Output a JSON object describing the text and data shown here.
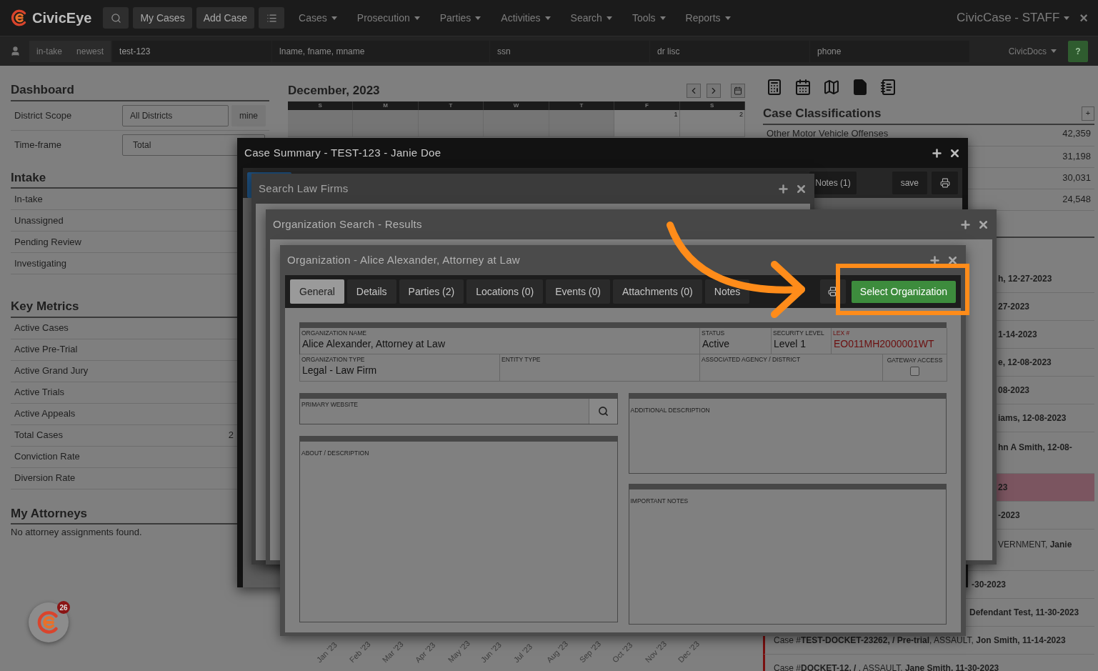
{
  "header": {
    "logo": "CivicEye",
    "nav_buttons": [
      "My Cases",
      "Add Case"
    ],
    "menus": [
      "Cases",
      "Prosecution",
      "Parties",
      "Activities",
      "Search",
      "Tools",
      "Reports"
    ],
    "account": "CivicCase - STAFF",
    "close": "×"
  },
  "search_bar": {
    "filters": [
      "in-take",
      "newest"
    ],
    "case_field": {
      "value": "test-123"
    },
    "fields": [
      {
        "placeholder": "lname, fname, mname"
      },
      {
        "placeholder": "ssn"
      },
      {
        "placeholder": "dr lisc"
      },
      {
        "placeholder": "phone"
      }
    ],
    "docs_menu": "CivicDocs",
    "help": "?"
  },
  "dashboard": {
    "title": "Dashboard",
    "scope": {
      "label": "District Scope",
      "value": "All Districts",
      "button": "mine"
    },
    "timeframe": {
      "label": "Time-frame",
      "value": "Total"
    }
  },
  "intake": {
    "title": "Intake",
    "rows": [
      "In-take",
      "Unassigned",
      "Pending Review",
      "Investigating"
    ]
  },
  "key_metrics": {
    "title": "Key Metrics",
    "rows": [
      {
        "label": "Active Cases"
      },
      {
        "label": "Active Pre-Trial"
      },
      {
        "label": "Active Grand Jury"
      },
      {
        "label": "Active Trials"
      },
      {
        "label": "Active Appeals"
      },
      {
        "label": "Total Cases",
        "value": "2"
      },
      {
        "label": "Conviction Rate"
      },
      {
        "label": "Diversion Rate"
      }
    ]
  },
  "attorneys": {
    "title": "My Attorneys",
    "empty": "No attorney assignments found."
  },
  "calendar": {
    "title": "December, 2023",
    "weekdays": [
      {
        "label": "S"
      },
      {
        "label": "M"
      },
      {
        "label": "T"
      },
      {
        "label": "W"
      },
      {
        "label": "T"
      },
      {
        "label": "F",
        "first_date": "1"
      },
      {
        "label": "S",
        "first_date": "2"
      }
    ]
  },
  "classifications": {
    "title": "Case Classifications",
    "add": "+",
    "rows": [
      {
        "label": "Other Motor Vehicle Offenses",
        "count": "42,359"
      },
      {
        "count": "31,198"
      },
      {
        "count": "30,031"
      },
      {
        "count": "24,548"
      }
    ]
  },
  "activity": [
    {
      "text": "h, 12-27-2023",
      "bold": true,
      "highlighted": false,
      "flagged": false
    },
    {
      "text": "27-2023",
      "bold": true,
      "highlighted": false,
      "flagged": false
    },
    {
      "text": "1-14-2023",
      "bold": true,
      "highlighted": false,
      "flagged": false
    },
    {
      "text": "e, 12-08-2023",
      "bold": true,
      "highlighted": false,
      "flagged": false
    },
    {
      "text": "08-2023",
      "bold": true,
      "highlighted": false,
      "flagged": false
    },
    {
      "text": "iams, 12-08-2023",
      "bold": true,
      "highlighted": false,
      "flagged": false
    },
    {
      "text": "hn A Smith, 12-08-",
      "bold": true,
      "highlighted": false,
      "flagged": false
    },
    {
      "text": "23",
      "bold": true,
      "highlighted": true,
      "flagged": false
    },
    {
      "text": "-2023",
      "bold": true,
      "highlighted": false,
      "flagged": false
    },
    {
      "text": "VERNMENT, **Janie**",
      "bold": false,
      "highlighted": false,
      "flagged": false
    },
    {
      "text": "-30-2023",
      "bold": true,
      "highlighted": false,
      "flagged": false
    },
    {
      "text": "Defendant Test, 11-30-2023",
      "bold": true,
      "highlighted": false,
      "flagged": false
    },
    {
      "text": "Case #**TEST-DOCKET-23262, / Pre-trial**, ASSAULT, **Jon Smith, 11-14-2023**",
      "bold": false,
      "highlighted": false,
      "flagged": true
    },
    {
      "text": "Case #**DOCKET-12, /** , ASSAULT, **Jane Smith, 11-30-2023**",
      "bold": false,
      "highlighted": false,
      "flagged": true
    }
  ],
  "chart_axis_labels": [
    "Jan '23",
    "Feb '23",
    "Mar '23",
    "Apr '23",
    "May '23",
    "Jun '23",
    "Jul '23",
    "Aug '23",
    "Sep '23",
    "Oct '23",
    "Nov '23",
    "Dec '23"
  ],
  "notification_badge": {
    "count": "26"
  },
  "case_summary": {
    "title": "Case Summary - TEST-123 - Janie Doe",
    "notes_tab": "Notes (1)",
    "save": "save"
  },
  "search_law_firms": {
    "title": "Search Law Firms"
  },
  "org_search": {
    "title": "Organization Search - Results"
  },
  "organization": {
    "title": "Organization - Alice Alexander, Attorney at Law",
    "tabs": [
      {
        "label": "General",
        "selected": true
      },
      {
        "label": "Details",
        "selected": false
      },
      {
        "label": "Parties (2)",
        "selected": false
      },
      {
        "label": "Locations (0)",
        "selected": false
      },
      {
        "label": "Events (0)",
        "selected": false
      },
      {
        "label": "Attachments (0)",
        "selected": false
      },
      {
        "label": "Notes",
        "selected": false
      }
    ],
    "select_button": "Select Organization",
    "name": {
      "label": "ORGANIZATION NAME",
      "value": "Alice Alexander, Attorney at Law"
    },
    "status": {
      "label": "STATUS",
      "value": "Active"
    },
    "security": {
      "label": "SECURITY LEVEL",
      "value": "Level 1"
    },
    "lex": {
      "label": "LEX #",
      "value": "EO011MH2000001WT"
    },
    "type": {
      "label": "ORGANIZATION TYPE",
      "value": "Legal - Law Firm"
    },
    "entity": {
      "label": "ENTITY TYPE"
    },
    "agency": {
      "label": "ASSOCIATED AGENCY / DISTRICT"
    },
    "gateway": {
      "label": "GATEWAY ACCESS",
      "checked": false
    },
    "website": {
      "label": "PRIMARY WEBSITE"
    },
    "about": {
      "label": "ABOUT / DESCRIPTION"
    },
    "additional": {
      "label": "ADDITIONAL DESCRIPTION"
    },
    "notes": {
      "label": "IMPORTANT NOTES"
    }
  }
}
